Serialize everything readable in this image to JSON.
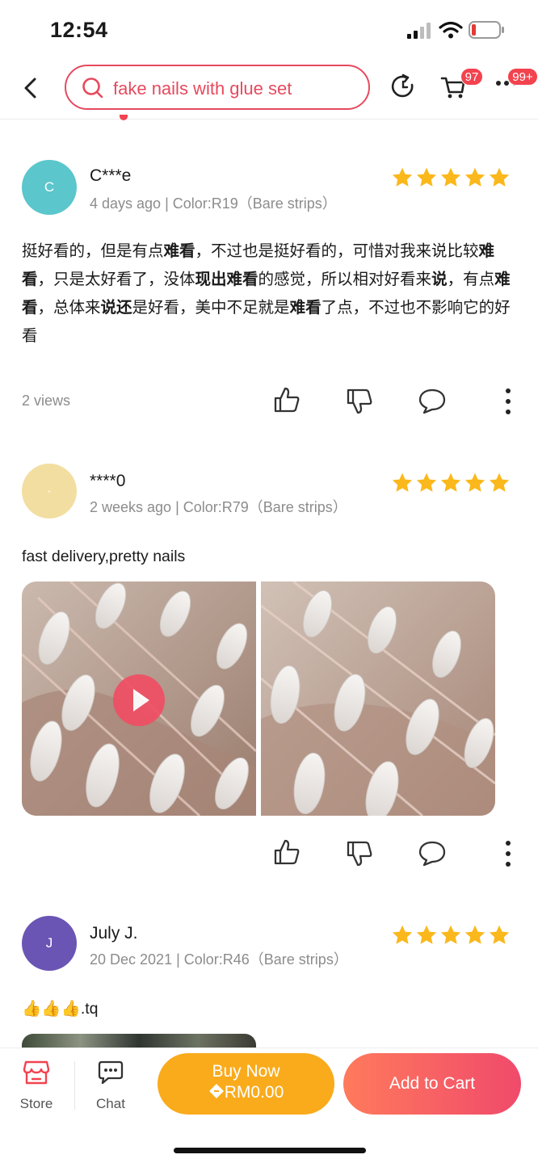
{
  "status_bar": {
    "time": "12:54"
  },
  "header": {
    "search_text": "fake nails with glue set",
    "cart_badge": "97",
    "more_badge": "99+"
  },
  "reviews": [
    {
      "avatar_letter": "C",
      "avatar_color": "#5bc6cc",
      "username": "C***e",
      "meta": "4  days ago | Color:R19（Bare strips）",
      "rating": 5,
      "text_segments": [
        {
          "t": "挺好看的，但是有点",
          "b": false
        },
        {
          "t": "难看",
          "b": true
        },
        {
          "t": "，不过也是挺好看的，可惜对我来说比较",
          "b": false
        },
        {
          "t": "难看",
          "b": true
        },
        {
          "t": "，只是太好看了，没体",
          "b": false
        },
        {
          "t": "现出难看",
          "b": true
        },
        {
          "t": "的感觉，所以相对好看来",
          "b": false
        },
        {
          "t": "说",
          "b": true
        },
        {
          "t": "，有点",
          "b": false
        },
        {
          "t": "难看",
          "b": true
        },
        {
          "t": "，总体来",
          "b": false
        },
        {
          "t": "说还",
          "b": true
        },
        {
          "t": "是好看，美中不足就是",
          "b": false
        },
        {
          "t": "难看",
          "b": true
        },
        {
          "t": "了点，不过也不影响它的好看",
          "b": false
        }
      ],
      "views": "2 views"
    },
    {
      "avatar_letter": "·",
      "avatar_color": "#f2dea0",
      "username": "****0",
      "meta": "2  weeks ago | Color:R79（Bare strips）",
      "rating": 5,
      "text": "fast delivery,pretty nails"
    },
    {
      "avatar_letter": "J",
      "avatar_color": "#6a55b5",
      "username": "July J.",
      "meta": "20 Dec 2021 | Color:R46（Bare strips）",
      "rating": 5,
      "text": "👍👍👍.tq"
    }
  ],
  "bottom_bar": {
    "store_label": "Store",
    "chat_label": "Chat",
    "buy_now_label": "Buy Now",
    "buy_now_price": "RM0.00",
    "add_to_cart_label": "Add to Cart"
  },
  "colors": {
    "accent": "#e64a5e",
    "star": "#fbb81c",
    "buy_now": "#f9ab1c",
    "add_to_cart_start": "#ff7a5c",
    "add_to_cart_end": "#f04a6b"
  }
}
